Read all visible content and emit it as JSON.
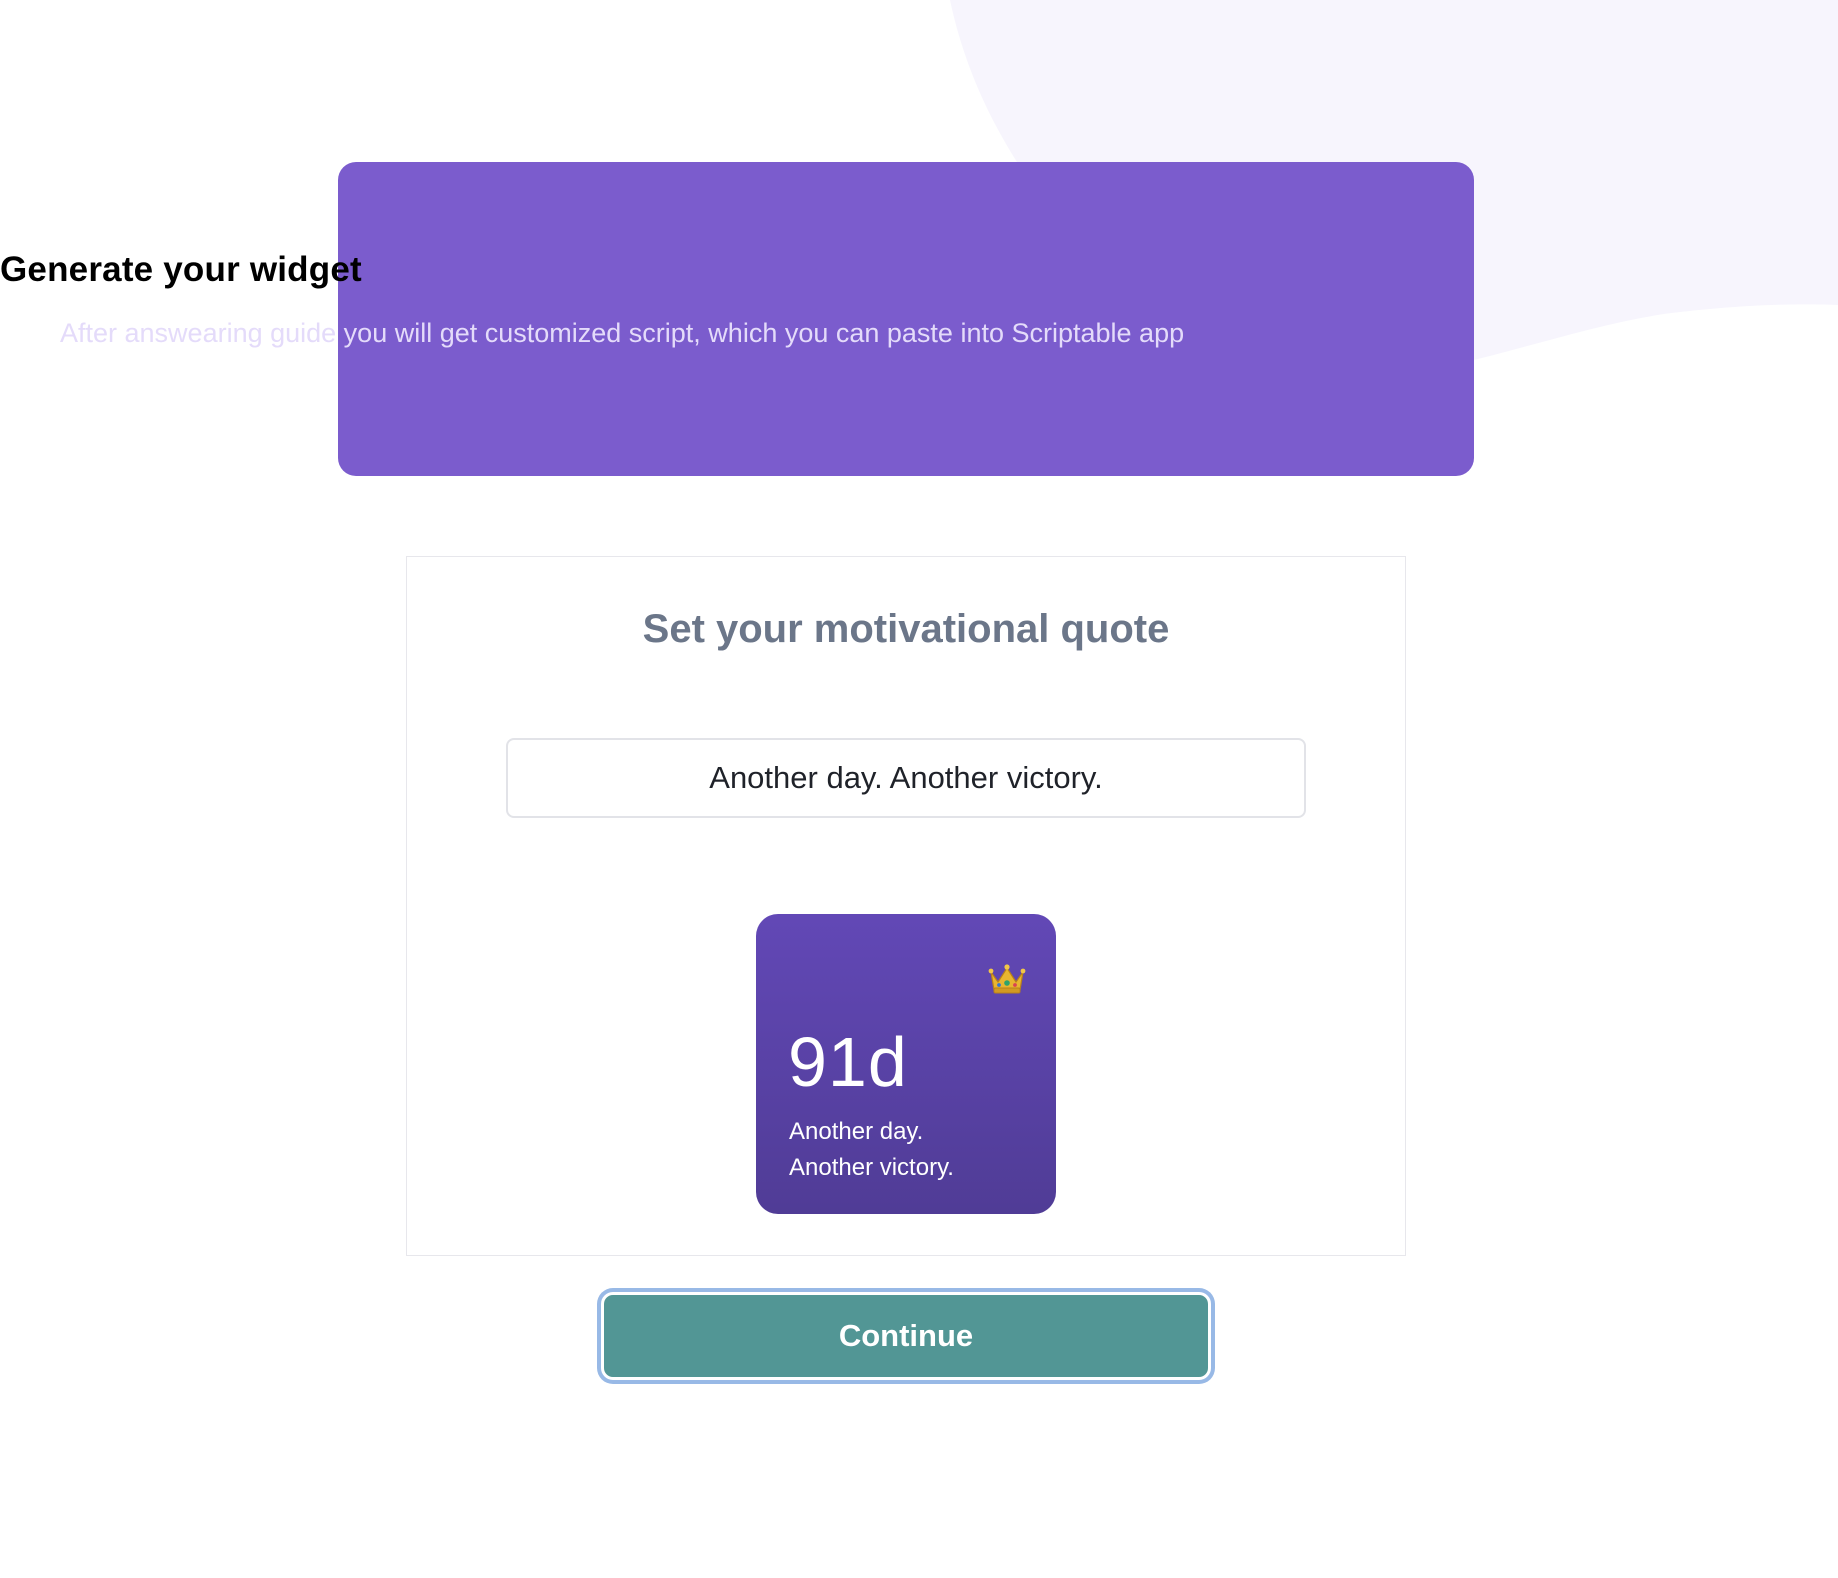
{
  "header": {
    "title": "Generate your widget",
    "subtitle": "After answearing guide you will get customized script, which you can paste into Scriptable app"
  },
  "step": {
    "title": "Set your motivational quote",
    "quote_input": {
      "value": "Another day. Another victory."
    }
  },
  "widget_preview": {
    "icon": "crown-icon",
    "days": "91d",
    "quote_line_1": "Another day.",
    "quote_line_2": "Another victory."
  },
  "actions": {
    "continue_label": "Continue"
  },
  "colors": {
    "header_background": "#7b5ccd",
    "widget_gradient_top": "#6248b6",
    "widget_gradient_bottom": "#503c96",
    "continue_button": "#529695",
    "focus_ring": "#98b9e6",
    "background_blob": "#f7f5fd"
  }
}
